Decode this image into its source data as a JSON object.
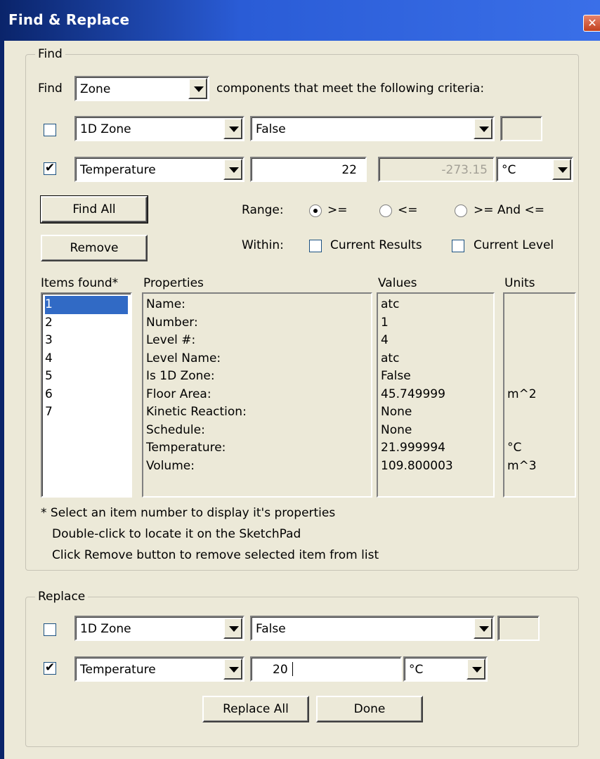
{
  "window": {
    "title": "Find & Replace",
    "close_glyph": "✕"
  },
  "find": {
    "legend": "Find",
    "find_label": "Find",
    "component_type": "Zone",
    "criteria_text": "components that meet the following criteria:",
    "criteria1": {
      "checked": false,
      "property": "1D Zone",
      "value": "False",
      "extra": ""
    },
    "criteria2": {
      "checked": true,
      "property": "Temperature",
      "value": "22",
      "limit": "-273.15",
      "unit": "°C"
    },
    "find_all_label": "Find All",
    "remove_label": "Remove",
    "range_label": "Range:",
    "range_options": [
      ">=",
      "<=",
      ">=  And <="
    ],
    "range_selected": 0,
    "within_label": "Within:",
    "within_current_results": "Current Results",
    "within_current_level": "Current Level",
    "items_header": "Items found*",
    "properties_header": "Properties",
    "values_header": "Values",
    "units_header": "Units",
    "items": [
      "1",
      "2",
      "3",
      "4",
      "5",
      "6",
      "7"
    ],
    "selected_item": 0,
    "properties": [
      "Name:",
      "Number:",
      "Level #:",
      "Level Name:",
      "Is 1D Zone:",
      "Floor Area:",
      "Kinetic Reaction:",
      "Schedule:",
      "Temperature:",
      "Volume:"
    ],
    "values": [
      "atc",
      "1",
      "4",
      "atc",
      "False",
      "45.749999",
      "None",
      "None",
      "21.999994",
      "109.800003"
    ],
    "units": [
      "",
      "",
      "",
      "",
      "",
      "m^2",
      "",
      "",
      "°C",
      "m^3"
    ],
    "notes": [
      "* Select an item number to display it's properties",
      "Double-click to locate it on the SketchPad",
      "Click Remove button to remove selected item from list"
    ]
  },
  "replace": {
    "legend": "Replace",
    "criteria1": {
      "checked": false,
      "property": "1D Zone",
      "value": "False",
      "extra": ""
    },
    "criteria2": {
      "checked": true,
      "property": "Temperature",
      "value": "20",
      "unit": "°C"
    },
    "replace_all_label": "Replace All",
    "done_label": "Done"
  },
  "icons": {
    "checkbox_check": "✔"
  }
}
